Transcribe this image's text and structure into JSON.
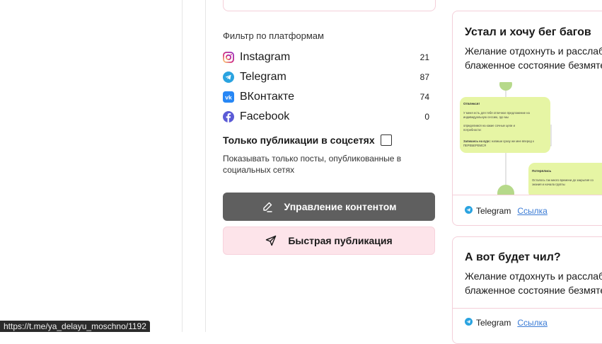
{
  "filter": {
    "title": "Фильтр по платформам",
    "platforms": [
      {
        "name": "Instagram",
        "count": "21",
        "icon": "instagram-icon",
        "color": "#d62976"
      },
      {
        "name": "Telegram",
        "count": "87",
        "icon": "telegram-icon",
        "color": "#2aa3e0"
      },
      {
        "name": "ВКонтакте",
        "count": "74",
        "icon": "vk-icon",
        "color": "#2787f5"
      },
      {
        "name": "Facebook",
        "count": "0",
        "icon": "facebook-icon",
        "color": "#5b5bd6"
      }
    ],
    "only_social_label": "Только публикации в соцсетях",
    "only_social_checked": false,
    "hint": "Показывать только посты, опубликованные в социальных сетях"
  },
  "actions": {
    "manage_label": "Управление контентом",
    "quick_publish_label": "Быстрая публикация"
  },
  "cards": [
    {
      "title": "Устал и хочу бег багов",
      "desc_line1": "Желание отдохнуть и расслабиться",
      "desc_line2": "блаженное состояние безмятежности",
      "platform": "Telegram",
      "link_label": "Ссылка"
    },
    {
      "title": "А вот будет чил?",
      "desc_line1": "Желание отдохнуть и расслабиться",
      "desc_line2": "блаженное состояние безмятежности",
      "platform": "Telegram",
      "link_label": "Ссылка"
    }
  ],
  "preview": {
    "note1_title": "Отвлекся!",
    "note1_line1": "У меня есть для тебя отличное предложение на",
    "note1_line2": "индивидуальную сессию, где мы",
    "note1_line3": "определимся на какие сочные цели и",
    "note1_line4": "потребности:",
    "note1_line5_bold": "Запишись на курс:",
    "note1_line5": " напиши сразу же мне вперед к",
    "note1_line6": "ПЕРЕБЕРЕМСЯ",
    "note2_title": "Потерялись",
    "note2_line1": "Осталось так много времени до закрытия со",
    "note2_line2": "знания и начала группы"
  },
  "status_url": "https://t.me/ya_delayu_moschno/1192",
  "colors": {
    "dark_button": "#5f5f5f",
    "pink_button": "#fde4ea",
    "card_border": "#f4cfd9",
    "link": "#3a7bd5",
    "preview_note": "#e6f5a4"
  }
}
